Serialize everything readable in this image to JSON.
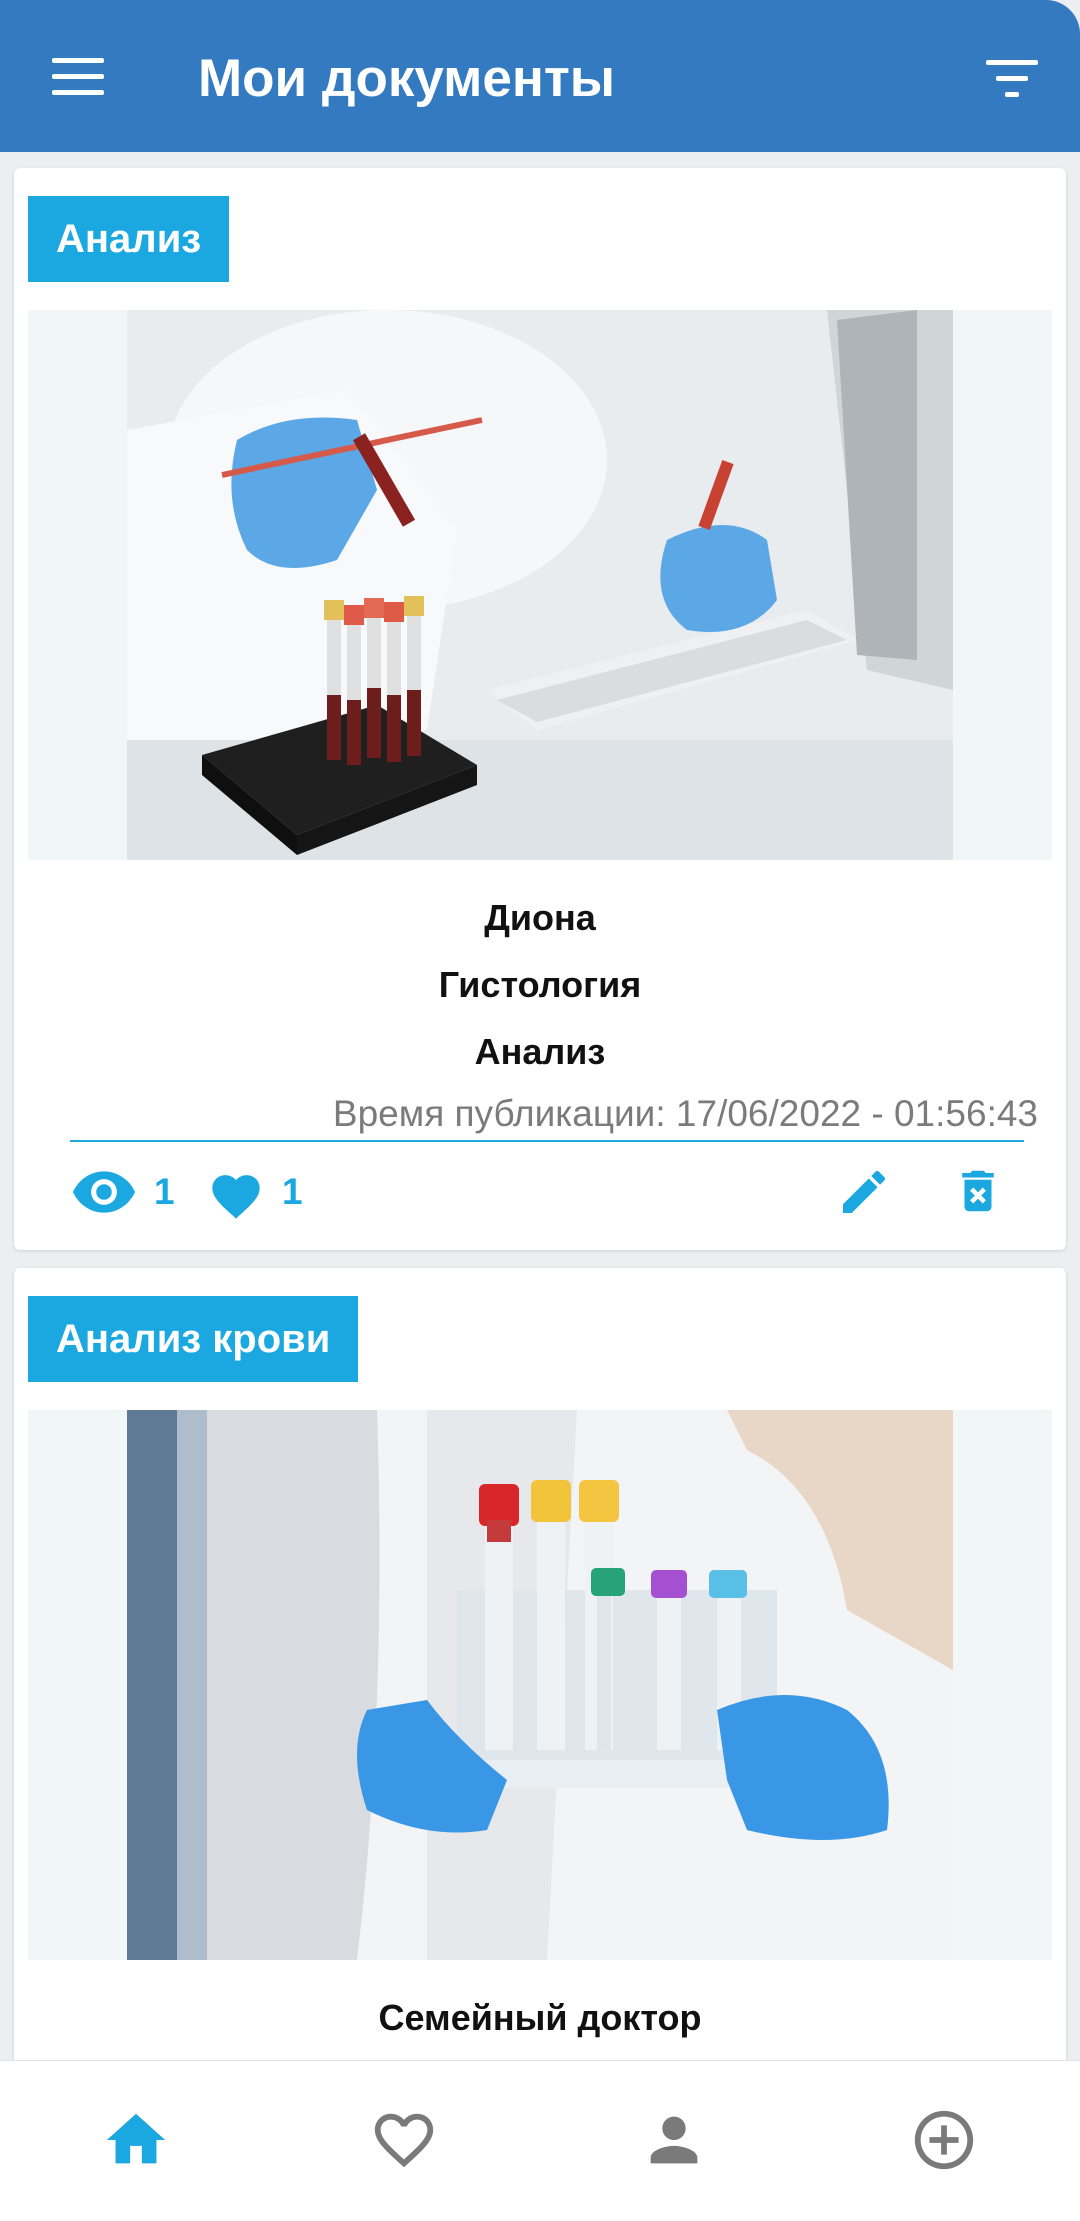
{
  "header": {
    "title": "Мои документы",
    "menu_icon": "hamburger-menu-icon",
    "filter_icon": "filter-icon"
  },
  "documents": [
    {
      "tag": "Анализ",
      "image": "lab-technician-blood-test-tubes-photo",
      "lines": [
        "Диона",
        "Гистология",
        "Анализ"
      ],
      "published": "Время публикации: 17/06/2022 - 01:56:43",
      "views": "1",
      "likes": "1",
      "edit_icon": "pencil-icon",
      "delete_icon": "trash-icon"
    },
    {
      "tag": "Анализ крови",
      "image": "gloved-hands-holding-test-tube-rack-photo",
      "lines": [
        "Семейный доктор"
      ]
    }
  ],
  "bottom_nav": {
    "items": [
      {
        "icon": "home-icon",
        "active": true
      },
      {
        "icon": "heart-outline-icon",
        "active": false
      },
      {
        "icon": "person-icon",
        "active": false
      },
      {
        "icon": "add-circle-icon",
        "active": false
      }
    ]
  },
  "colors": {
    "header": "#337ac0",
    "accent": "#1ba8e0",
    "inactive_icon": "#7a7a7a"
  }
}
